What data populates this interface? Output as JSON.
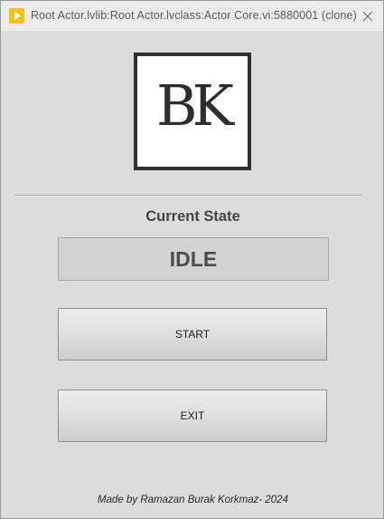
{
  "window": {
    "title": "Root Actor.lvlib:Root Actor.lvclass:Actor Core.vi:5880001 (clone)",
    "app_icon": "labview-run-icon",
    "close_icon": "close-icon"
  },
  "logo": {
    "letters": "BK"
  },
  "state": {
    "label": "Current State",
    "value": "IDLE"
  },
  "buttons": {
    "start_label": "START",
    "exit_label": "EXIT"
  },
  "footer": {
    "text": "Made by Ramazan Burak Korkmaz- 2024"
  },
  "colors": {
    "title_icon": "#f4c20d",
    "logo_border": "#2f2f2f"
  }
}
